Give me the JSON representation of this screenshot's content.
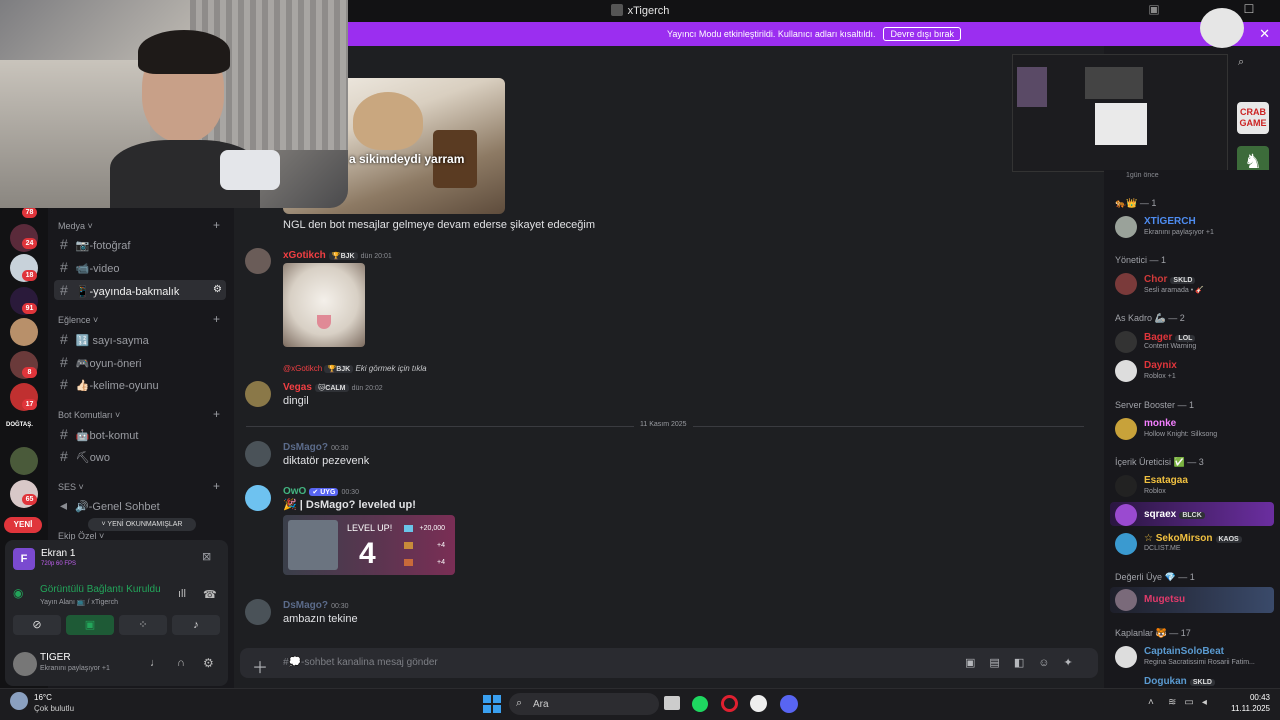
{
  "window": {
    "title": "xTigerch"
  },
  "banner": {
    "text": "Yayıncı Modu etkinleştirildi. Kullanıcı adları kısaltıldı.",
    "button": "Devre dışı bırak"
  },
  "guild_badges": [
    "78",
    "24",
    "18",
    "91",
    "8",
    "17",
    "65"
  ],
  "guild_label": "DOĞTAŞ.",
  "yeni": "YENİ",
  "new_unread": "YENİ OKUNMAMIŞLAR",
  "sidebar": {
    "cat_media": "Medya",
    "ch_foto": "📷-fotoğraf",
    "ch_video": "📹-video",
    "ch_yayinda": "📱-yayında-bakmalık",
    "cat_fun": "Eğlence",
    "ch_sayi": "🔢 sayı-sayma",
    "ch_oyun": "🎮oyun-öneri",
    "ch_kelime": "👍🏻-kelime-oyunu",
    "cat_bot": "Bot Komutları",
    "ch_bot": "🤖bot-komut",
    "ch_owo": "⛏owo",
    "cat_ses": "SES",
    "ch_genel": "🔊-Genel Sohbet",
    "cat_ekip": "Ekip Özel"
  },
  "voice": {
    "screen_title": "Ekran 1",
    "screen_sub": "720p 60 FPS",
    "conn": "Görüntülü Bağlantı Kuruldu",
    "conn_sub": "Yayın Alanı 📺 / xTigerch"
  },
  "user": {
    "name": "TIGER",
    "status": "Ekranını paylaşıyor +1"
  },
  "chat": {
    "meme_caption": "a sikimdeydi yarram",
    "msg0": "NGL den bot mesajlar gelmeye devam ederse şikayet edeceğim",
    "m1_user": "xGotikch",
    "m1_tag": "🏆BJK",
    "m1_ts": "dün 20:01",
    "reply_user": "@xGotikch",
    "reply_tag": "🏆BJK",
    "reply_text": "Eki görmek için tıkla",
    "m2_user": "Vegas",
    "m2_tag": "🐱CALM",
    "m2_ts": "dün 20:02",
    "m2_text": "dingil",
    "divider": "11 Kasım 2025",
    "m3_user": "DsMago?",
    "m3_ts": "00:30",
    "m3_text": "diktatör pezevenk",
    "m4_user": "OwO",
    "m4_tag": "✔ UYG",
    "m4_ts": "00:30",
    "m4_text": "🎉 | DsMago? leveled up!",
    "lvl_label": "LEVEL UP!",
    "lvl_num": "4",
    "lvl_r1": "+20,000",
    "lvl_r2": "+4",
    "lvl_r3": "+4",
    "m5_user": "DsMago?",
    "m5_ts": "00:30",
    "m5_text": "ambazın tekine",
    "composer_placeholder": "#💭-sohbet kanalina mesaj gönder"
  },
  "members": {
    "ago": "1gün önce",
    "g1": "🐅👑 — 1",
    "u1": "XTİGERCH",
    "u1s": "Ekranını paylaşıyor +1",
    "g2": "Yönetici — 1",
    "u2": "Chor",
    "u2t": "SKLD",
    "u2s": "Sesli aramada • 🎸",
    "g3": "As Kadro 🦾 — 2",
    "u3": "Bager",
    "u3t": "LOL",
    "u3s": "Content Warning",
    "u4": "Daynix",
    "u4s": "Roblox +1",
    "g4": "Server Booster — 1",
    "u5": "monke",
    "u5s": "Hollow Knight: Silksong",
    "g5": "İçerik Üreticisi ✅ — 3",
    "u6": "Esatagaa",
    "u6s": "Roblox",
    "u7": "sqraex",
    "u7t": "BLCK",
    "u8": "☆ SekoMirson",
    "u8t": "KAOS",
    "u8s": "DCLIST.ME",
    "g6": "Değerli Üye 💎 — 1",
    "u9": "Mugetsu",
    "g7": "Kaplanlar 🐯 — 17",
    "u10": "CaptainSoloBeat",
    "u10s": "Regina Sacratissimi Rosarii Fatim...",
    "u11": "Dogukan",
    "u11t": "SKLD"
  },
  "taskbar": {
    "temp": "16°C",
    "weather": "Çok bulutlu",
    "search": "Ara",
    "time": "00:43",
    "date": "11.11.2025"
  },
  "colors": {
    "accent": "#9b2ef0",
    "red": "#f23f43",
    "green": "#23a55a",
    "blurple": "#5865f2"
  }
}
